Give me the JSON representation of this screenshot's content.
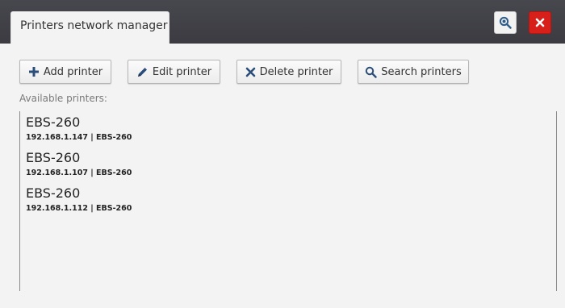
{
  "window": {
    "tab_title": "Printers network manager",
    "header_buttons": [
      {
        "icon": "zoom-search-icon",
        "color": "#f2f2f2"
      },
      {
        "icon": "close-icon",
        "color": "#d8201b"
      }
    ]
  },
  "toolbar": {
    "add_label": "Add printer",
    "edit_label": "Edit printer",
    "delete_label": "Delete printer",
    "search_label": "Search printers"
  },
  "list": {
    "label": "Available printers:",
    "items": [
      {
        "name": "EBS-260",
        "detail": "192.168.1.147 | EBS-260"
      },
      {
        "name": "EBS-260",
        "detail": "192.168.1.107 | EBS-260"
      },
      {
        "name": "EBS-260",
        "detail": "192.168.1.112 | EBS-260"
      }
    ]
  },
  "colors": {
    "titlebar": "#3f3f45",
    "close_button": "#d8201b",
    "background": "#f3f3f3"
  }
}
